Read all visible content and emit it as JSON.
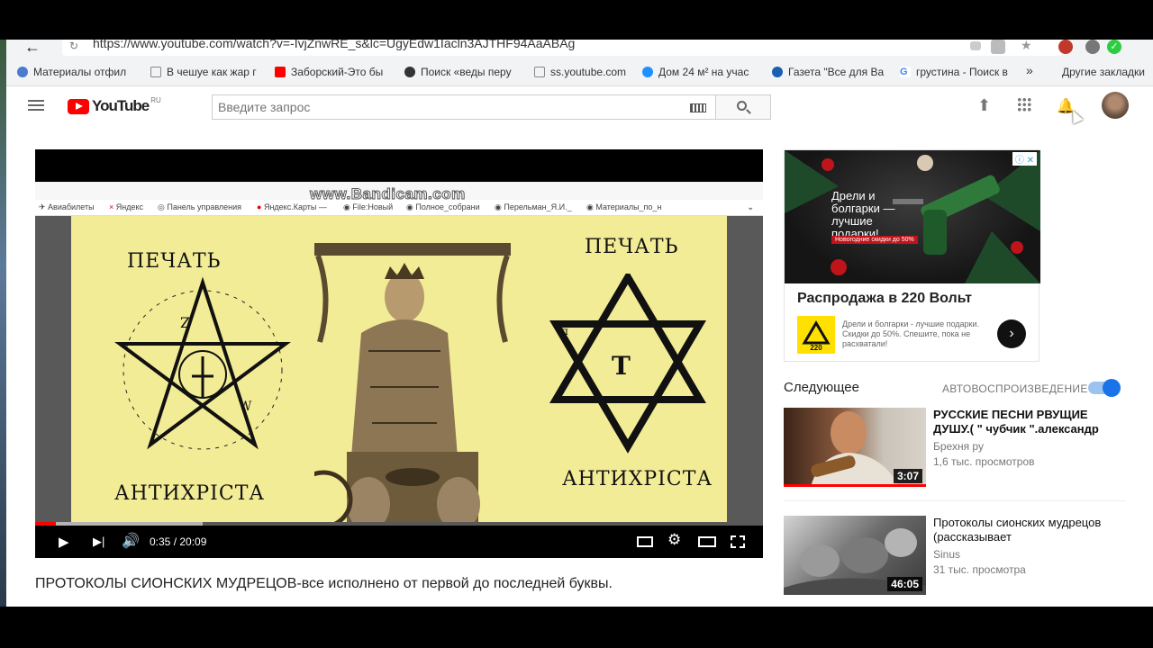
{
  "browser": {
    "url": "https://www.youtube.com/watch?v=-IvjZnwRE_s&lc=UgyEdw1Iacln3AJTHF94AaABAg",
    "bookmarks": [
      "Материалы отфил",
      "В чешуе как жар г",
      "Заборский-Это бы",
      "Поиск «веды перу",
      "ss.youtube.com",
      "Дом 24 м² на учас",
      "Газета \"Все для Ва",
      "грустина - Поиск в"
    ],
    "more_chevron": "»",
    "other_bookmarks": "Другие закладки"
  },
  "youtube": {
    "logo_text": "YouTube",
    "logo_region": "RU",
    "search_placeholder": "Введите запрос"
  },
  "player": {
    "watermark": "www.Bandicam.com",
    "inner_bookmarks": [
      "Авиабилеты",
      "Яндекс",
      "Панель управления",
      "Яндекс.Карты —",
      "File:Новый",
      "Полное_собрани",
      "Перельман_Я.И._",
      "Материалы_по_н"
    ],
    "seal_left_title": "ПЕЧАТЬ",
    "seal_left_bottom": "АНТИХРІСТА",
    "seal_right_title": "ПЕЧАТЬ",
    "seal_right_bottom": "АНТИХРІСТА",
    "time": "0:35 / 20:09",
    "progress": 0.029,
    "buffered": 0.23
  },
  "video": {
    "title": "ПРОТОКОЛЫ СИОНСКИХ МУДРЕЦОВ-все исполнено от первой до последней буквы."
  },
  "ad": {
    "tagline": "Дрели и болгарки — лучшие подарки!",
    "promo": "Новогодние скидки до 50%",
    "headline": "Распродажа в 220 Вольт",
    "logo_text": "220",
    "description": "Дрели и болгарки - лучшие подарки. Скидки до 50%. Спешите, пока не расхватали!",
    "arrow": "›"
  },
  "sidebar": {
    "next_label": "Следующее",
    "autoplay_label": "АВТОВОСПРОИЗВЕДЕНИЕ",
    "autoplay_on": true,
    "videos": [
      {
        "title": "РУССКИЕ ПЕСНИ РВУЩИЕ ДУШУ.( \" чубчик \".александр",
        "channel": "Брехня ру",
        "views": "1,6 тыс. просмотров",
        "duration": "3:07"
      },
      {
        "title": "Протоколы сионских мудрецов (рассказывает",
        "channel": "Sinus",
        "views": "31 тыс. просмотра",
        "duration": "46:05"
      }
    ]
  }
}
